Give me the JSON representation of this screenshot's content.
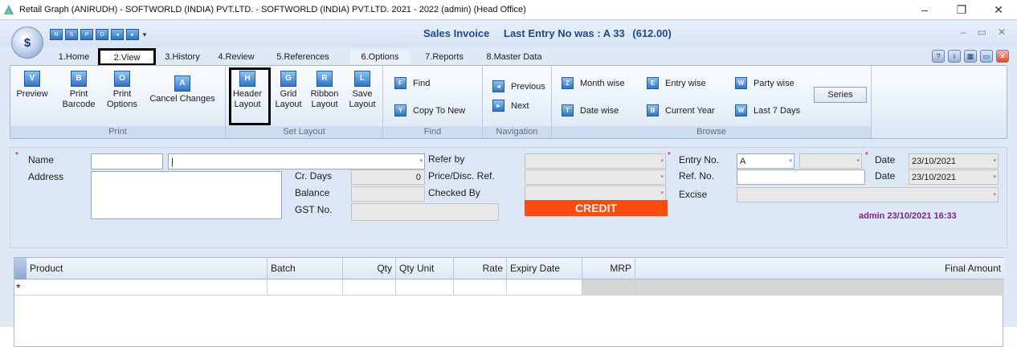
{
  "window": {
    "os_title": "Retail Graph (ANIRUDH) - SOFTWORLD (INDIA) PVT.LTD. - SOFTWORLD (INDIA) PVT.LTD.  2021 - 2022 (admin) (Head Office)",
    "minimize": "–",
    "maximize": "❐",
    "close": "✕"
  },
  "app": {
    "orb_text": "$",
    "title": "Sales Invoice",
    "last_entry": "Last Entry No was : A 33",
    "last_amount": "(612.00)",
    "mdi_min": "–",
    "mdi_max": "▭",
    "mdi_close": "✕",
    "qat": [
      "N",
      "S",
      "P",
      "D",
      "◂",
      "▸"
    ]
  },
  "tabs": [
    "1.Home",
    "2.View",
    "3.History",
    "4.Review",
    "5.References",
    "6.Options",
    "7.Reports",
    "8.Master Data"
  ],
  "ribbon": {
    "print": {
      "label": "Print",
      "preview": "Preview",
      "print_barcode_1": "Print",
      "print_barcode_2": "Barcode",
      "print_options_1": "Print",
      "print_options_2": "Options",
      "cancel_changes": "Cancel Changes"
    },
    "set_layout": {
      "label": "Set Layout",
      "header_1": "Header",
      "header_2": "Layout",
      "grid_1": "Grid",
      "grid_2": "Layout",
      "ribbon_1": "Ribbon",
      "ribbon_2": "Layout",
      "save_1": "Save",
      "save_2": "Layout"
    },
    "find": {
      "label": "Find",
      "find": "Find",
      "copy_to_new": "Copy To New"
    },
    "navigation": {
      "label": "Navigation",
      "previous": "Previous",
      "next": "Next"
    },
    "browse": {
      "label": "Browse",
      "month_wise": "Month wise",
      "entry_wise": "Entry wise",
      "party_wise": "Party wise",
      "date_wise": "Date wise",
      "current_year": "Current Year",
      "last_7_days": "Last 7 Days",
      "series": "Series"
    }
  },
  "form": {
    "name_label": "Name",
    "address_label": "Address",
    "cr_days_label": "Cr. Days",
    "cr_days_value": "0",
    "balance_label": "Balance",
    "gst_label": "GST No.",
    "refer_by_label": "Refer by",
    "price_disc_label": "Price/Disc. Ref.",
    "checked_by_label": "Checked By",
    "credit_label": "CREDIT",
    "entry_no_label": "Entry No.",
    "entry_no_series": "A",
    "ref_no_label": "Ref. No.",
    "excise_label": "Excise",
    "date_label": "Date",
    "date_value": "23/10/2021",
    "ref_date_label": "Date",
    "ref_date_value": "23/10/2021",
    "user_stamp": "admin 23/10/2021 16:33",
    "required_mark": "*"
  },
  "grid": {
    "columns": [
      "Product",
      "Batch",
      "Qty",
      "Qty Unit",
      "Rate",
      "Expiry Date",
      "MRP",
      "Final Amount"
    ],
    "new_row_marker": "*"
  }
}
